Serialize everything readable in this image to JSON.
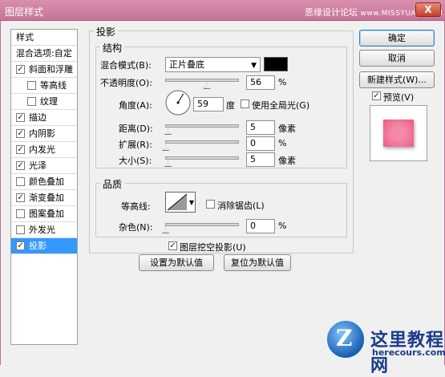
{
  "window": {
    "title": "图层样式",
    "watermark": "思缘设计论坛",
    "watermark_url": "www.MISSYUAN.COM",
    "close_label": "X"
  },
  "left_panel": {
    "header": "样式",
    "blend_options": "混合选项:自定",
    "items": [
      {
        "label": "斜面和浮雕",
        "checked": true
      },
      {
        "label": "等高线",
        "checked": false
      },
      {
        "label": "纹理",
        "checked": false
      },
      {
        "label": "描边",
        "checked": true
      },
      {
        "label": "内阴影",
        "checked": true
      },
      {
        "label": "内发光",
        "checked": true
      },
      {
        "label": "光泽",
        "checked": true
      },
      {
        "label": "颜色叠加",
        "checked": false
      },
      {
        "label": "渐变叠加",
        "checked": true
      },
      {
        "label": "图案叠加",
        "checked": false
      },
      {
        "label": "外发光",
        "checked": false
      },
      {
        "label": "投影",
        "checked": true
      }
    ]
  },
  "drop_shadow": {
    "title": "投影",
    "structure": {
      "title": "结构",
      "blend_mode_label": "混合模式(B):",
      "blend_mode_value": "正片叠底",
      "shadow_color": "#000000",
      "opacity_label": "不透明度(O):",
      "opacity_value": "56",
      "opacity_unit": "%",
      "opacity_level": 0.56,
      "angle_label": "角度(A):",
      "angle_value": "59",
      "angle_unit": "度",
      "global_light_label": "使用全局光(G)",
      "global_light_checked": false,
      "distance_label": "距离(D):",
      "distance_value": "5",
      "distance_unit": "像素",
      "spread_label": "扩展(R):",
      "spread_value": "0",
      "spread_unit": "%",
      "size_label": "大小(S):",
      "size_value": "5",
      "size_unit": "像素"
    },
    "quality": {
      "title": "品质",
      "contour_label": "等高线:",
      "antialias_label": "消除锯齿(L)",
      "antialias_checked": false,
      "noise_label": "杂色(N):",
      "noise_value": "0",
      "noise_unit": "%"
    },
    "knockout_label": "图层挖空投影(U)",
    "knockout_checked": true,
    "make_default_label": "设置为默认值",
    "reset_default_label": "复位为默认值"
  },
  "buttons": {
    "ok": "确定",
    "cancel": "取消",
    "new_style": "新建样式(W)...",
    "preview_label": "预览(V)",
    "preview_checked": true
  },
  "logo": {
    "cn": "这里教程网",
    "en": "herecours.com",
    "mark": "Z"
  }
}
